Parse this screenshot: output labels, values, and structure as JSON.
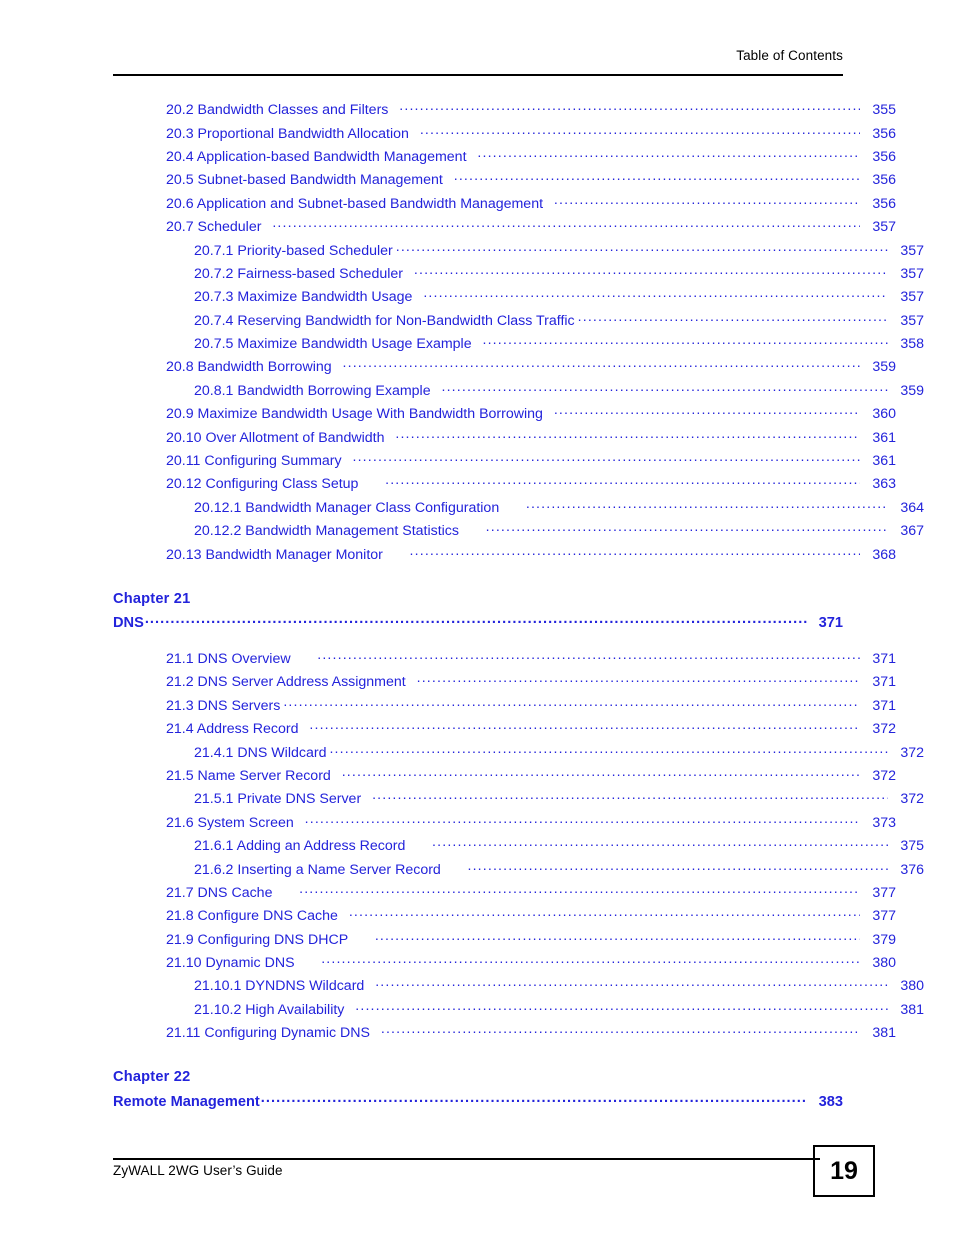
{
  "header": {
    "title": "Table of Contents"
  },
  "footer": {
    "guide_title": "ZyWALL 2WG User’s Guide",
    "page_number": "19"
  },
  "toc": {
    "entries": [
      {
        "level": 1,
        "title": "20.2 Bandwidth Classes and Filters",
        "gap": "gap",
        "page": "355"
      },
      {
        "level": 1,
        "title": "20.3 Proportional Bandwidth Allocation",
        "gap": "gap",
        "page": "356"
      },
      {
        "level": 1,
        "title": "20.4 Application-based Bandwidth Management",
        "gap": "gap",
        "page": "356"
      },
      {
        "level": 1,
        "title": "20.5 Subnet-based Bandwidth Management",
        "gap": "gap",
        "page": "356"
      },
      {
        "level": 1,
        "title": "20.6 Application and Subnet-based Bandwidth Management",
        "gap": "gap",
        "page": "356"
      },
      {
        "level": 1,
        "title": "20.7 Scheduler",
        "gap": "gap",
        "page": "357"
      },
      {
        "level": 2,
        "title": "20.7.1 Priority-based Scheduler",
        "gap": "",
        "page": "357"
      },
      {
        "level": 2,
        "title": "20.7.2 Fairness-based Scheduler",
        "gap": "gap",
        "page": "357"
      },
      {
        "level": 2,
        "title": "20.7.3 Maximize Bandwidth Usage",
        "gap": "gap",
        "page": "357"
      },
      {
        "level": 2,
        "title": "20.7.4 Reserving Bandwidth for Non-Bandwidth Class Traffic",
        "gap": "",
        "page": "357"
      },
      {
        "level": 2,
        "title": "20.7.5 Maximize Bandwidth Usage Example",
        "gap": "gap",
        "page": "358"
      },
      {
        "level": 1,
        "title": "20.8 Bandwidth Borrowing",
        "gap": "gap",
        "page": "359"
      },
      {
        "level": 2,
        "title": "20.8.1 Bandwidth Borrowing Example",
        "gap": "gap",
        "page": "359"
      },
      {
        "level": 1,
        "title": "20.9 Maximize Bandwidth Usage With Bandwidth Borrowing",
        "gap": "gap",
        "page": "360"
      },
      {
        "level": 1,
        "title": "20.10 Over Allotment of Bandwidth",
        "gap": "gap",
        "page": "361"
      },
      {
        "level": 1,
        "title": "20.11 Configuring Summary",
        "gap": "gap",
        "page": "361"
      },
      {
        "level": 1,
        "title": "20.12 Configuring Class Setup",
        "gap": "gap2",
        "page": "363"
      },
      {
        "level": 2,
        "title": "20.12.1 Bandwidth Manager Class Configuration",
        "gap": "gap2",
        "page": "364"
      },
      {
        "level": 2,
        "title": "20.12.2 Bandwidth Management Statistics",
        "gap": "gap2",
        "page": "367"
      },
      {
        "level": 1,
        "title": "20.13 Bandwidth Manager Monitor",
        "gap": "gap2",
        "page": "368"
      }
    ],
    "chapter21": {
      "label": "Chapter  21",
      "name": "DNS",
      "page": "371"
    },
    "entries21": [
      {
        "level": 1,
        "title": "21.1 DNS Overview",
        "gap": "gap2",
        "page": "371"
      },
      {
        "level": 1,
        "title": "21.2 DNS Server Address Assignment",
        "gap": "gap",
        "page": "371"
      },
      {
        "level": 1,
        "title": "21.3 DNS Servers",
        "gap": "",
        "page": "371"
      },
      {
        "level": 1,
        "title": "21.4 Address Record",
        "gap": "gap",
        "page": "372"
      },
      {
        "level": 2,
        "title": "21.4.1 DNS Wildcard",
        "gap": "",
        "page": "372"
      },
      {
        "level": 1,
        "title": "21.5 Name Server Record",
        "gap": "gap",
        "page": "372"
      },
      {
        "level": 2,
        "title": "21.5.1 Private DNS Server",
        "gap": "gap",
        "page": "372"
      },
      {
        "level": 1,
        "title": "21.6 System Screen",
        "gap": "gap",
        "page": "373"
      },
      {
        "level": 2,
        "title": "21.6.1 Adding an Address Record",
        "gap": "gap2",
        "page": "375"
      },
      {
        "level": 2,
        "title": "21.6.2 Inserting a Name Server Record",
        "gap": "gap2",
        "page": "376"
      },
      {
        "level": 1,
        "title": "21.7 DNS Cache",
        "gap": "gap2",
        "page": "377"
      },
      {
        "level": 1,
        "title": "21.8 Configure DNS Cache",
        "gap": "gap",
        "page": "377"
      },
      {
        "level": 1,
        "title": "21.9 Configuring DNS DHCP",
        "gap": "gap2",
        "page": "379"
      },
      {
        "level": 1,
        "title": "21.10 Dynamic DNS",
        "gap": "gap2",
        "page": "380"
      },
      {
        "level": 2,
        "title": "21.10.1 DYNDNS Wildcard",
        "gap": "gap",
        "page": "380"
      },
      {
        "level": 2,
        "title": "21.10.2 High Availability",
        "gap": "gap",
        "page": "381"
      },
      {
        "level": 1,
        "title": "21.11 Configuring Dynamic DNS",
        "gap": "gap",
        "page": "381"
      }
    ],
    "chapter22": {
      "label": "Chapter  22",
      "name": "Remote Management",
      "page": "383"
    }
  },
  "colors": {
    "link_blue": "#2323DB",
    "text_black": "#000000"
  }
}
